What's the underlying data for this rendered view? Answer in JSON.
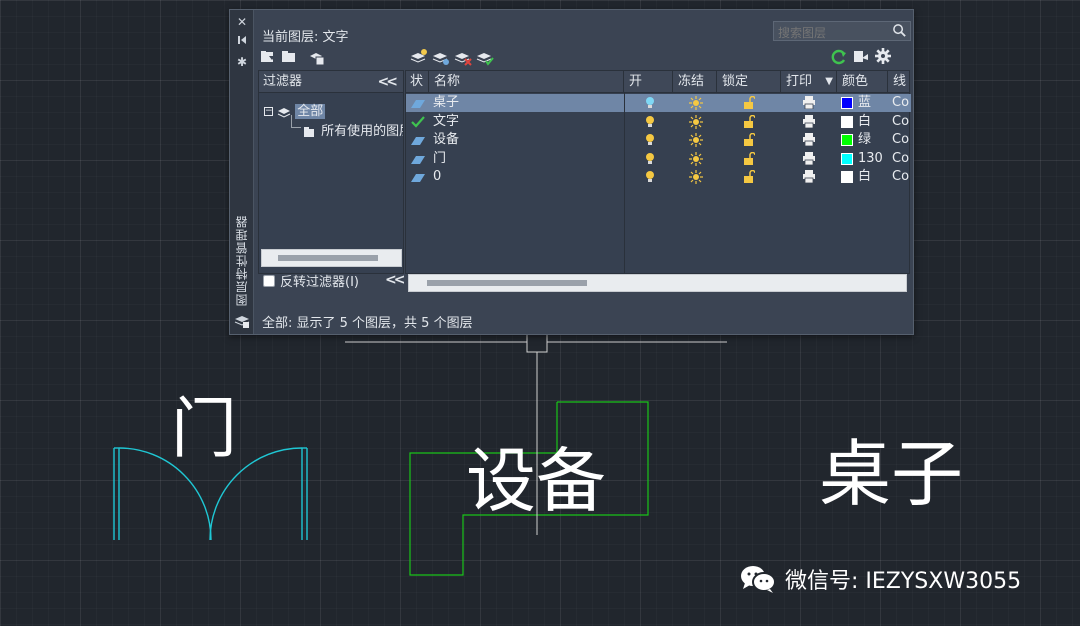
{
  "palette": {
    "title_vertical": "图层特性管理器",
    "current_layer": "当前图层: 文字",
    "search_placeholder": "搜索图层",
    "filters_header": "过滤器",
    "filter_tree": {
      "root": "全部",
      "child": "所有使用的图层"
    },
    "invert_filter_label": "反转过滤器(I)",
    "columns": [
      "状",
      "名称",
      "开",
      "冻结",
      "锁定",
      "打印",
      "颜色",
      "线型"
    ],
    "layers": [
      {
        "status": "layer",
        "name": "桌子",
        "color_name": "蓝",
        "color_hex": "#0000ff",
        "linetype": "Co",
        "selected": true,
        "on": true
      },
      {
        "status": "current",
        "name": "文字",
        "color_name": "白",
        "color_hex": "#ffffff",
        "linetype": "Co",
        "selected": false,
        "on": true
      },
      {
        "status": "layer",
        "name": "设备",
        "color_name": "绿",
        "color_hex": "#00ff00",
        "linetype": "Co",
        "selected": false,
        "on": true
      },
      {
        "status": "layer",
        "name": "门",
        "color_name": "130",
        "color_hex": "#00ffff",
        "linetype": "Co",
        "selected": false,
        "on": true
      },
      {
        "status": "layer",
        "name": "0",
        "color_name": "白",
        "color_hex": "#ffffff",
        "linetype": "Co",
        "selected": false,
        "on": true
      }
    ],
    "status_text": "全部: 显示了 5 个图层，共 5 个图层",
    "icons": [
      "close-icon",
      "auto-hide-icon",
      "settings-icon",
      "new-property-filter-icon",
      "new-group-filter-icon",
      "layer-states-icon",
      "new-layer-icon",
      "new-layer-vp-frozen-icon",
      "delete-layer-icon",
      "set-current-icon",
      "refresh-icon",
      "gear-icon"
    ]
  },
  "drawing": {
    "labels": {
      "door": "门",
      "equipment": "设备",
      "table": "桌子"
    },
    "colors": {
      "door_lines": "#1fc7d4",
      "equipment_lines": "#19c419",
      "text": "#ffffff",
      "crosshair": "#d0d0d0"
    }
  },
  "watermark": {
    "text": "微信号: IEZYSXW3055"
  }
}
